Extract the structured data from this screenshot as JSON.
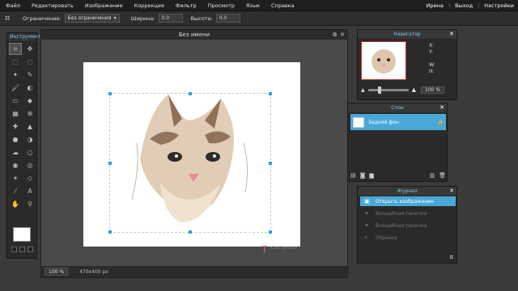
{
  "menu": {
    "items": [
      "Файл",
      "Редактировать",
      "Изображение",
      "Коррекция",
      "Фильтр",
      "Просмотр",
      "Язык",
      "Справка"
    ],
    "user": "Ирина",
    "logout": "Выход",
    "settings": "Настройки",
    "sep": "|"
  },
  "options": {
    "constraint_label": "Ограничение:",
    "constraint_value": "Без ограничения",
    "width_label": "Ширина:",
    "width_value": "0.0",
    "height_label": "Высота:",
    "height_value": "0.0"
  },
  "toolbox": {
    "title": "Инструмент"
  },
  "document": {
    "title": "Без имени",
    "zoom": "100",
    "zoom_unit": "%",
    "size": "470x400 px",
    "watermark_letter": "T",
    "watermark_text": "Cat vector"
  },
  "navigator": {
    "title": "Навигатор",
    "x_label": "X:",
    "y_label": "Y:",
    "w_label": "W:",
    "h_label": "H:",
    "zoom": "100",
    "zoom_unit": "%"
  },
  "layers": {
    "title": "Слои",
    "items": [
      {
        "name": "Задний фон"
      }
    ]
  },
  "history": {
    "title": "Журнал",
    "items": [
      {
        "label": "Открыть изображение",
        "active": true
      },
      {
        "label": "Волшебная палочка",
        "active": false
      },
      {
        "label": "Волшебная палочка",
        "active": false
      },
      {
        "label": "Обрезка",
        "active": false
      }
    ]
  },
  "colors": {
    "accent": "#4aa8d8",
    "foreground_swatch": "#ffffff",
    "background_swatch": "#222222"
  }
}
